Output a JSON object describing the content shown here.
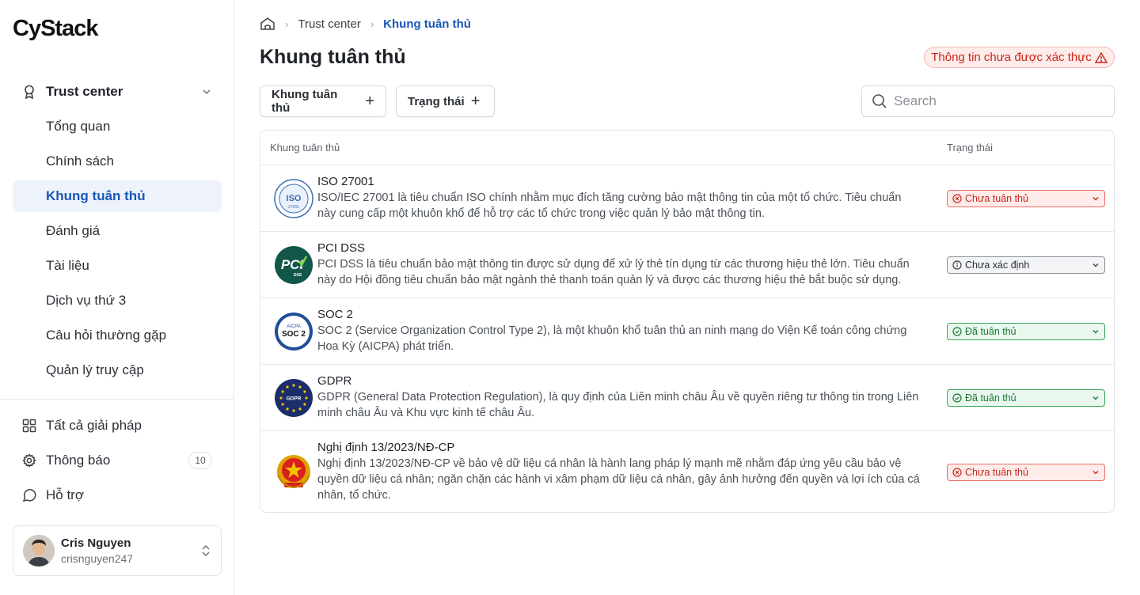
{
  "brand": {
    "logo_text": "CyStack"
  },
  "sidebar": {
    "group_label": "Trust center",
    "items": [
      {
        "label": "Tổng quan",
        "active": false
      },
      {
        "label": "Chính sách",
        "active": false
      },
      {
        "label": "Khung tuân thủ",
        "active": true
      },
      {
        "label": "Đánh giá",
        "active": false
      },
      {
        "label": "Tài liệu",
        "active": false
      },
      {
        "label": "Dịch vụ thứ 3",
        "active": false
      },
      {
        "label": "Câu hỏi thường gặp",
        "active": false
      },
      {
        "label": "Quản lý truy cập",
        "active": false
      }
    ],
    "bottom": [
      {
        "label": "Tất cả giải pháp",
        "icon": "grid-icon"
      },
      {
        "label": "Thông báo",
        "icon": "gear-icon",
        "badge": "10"
      },
      {
        "label": "Hỗ trợ",
        "icon": "chat-icon"
      }
    ],
    "user": {
      "name": "Cris Nguyen",
      "handle": "crisnguyen247"
    }
  },
  "breadcrumb": {
    "root": "Trust center",
    "current": "Khung tuân thủ"
  },
  "page": {
    "title": "Khung tuân thủ",
    "warning": "Thông tin chưa được xác thực"
  },
  "filters": {
    "framework": "Khung tuân thủ",
    "status": "Trạng thái"
  },
  "search": {
    "placeholder": "Search"
  },
  "table": {
    "headers": {
      "framework": "Khung tuân thủ",
      "status": "Trạng thái"
    },
    "rows": [
      {
        "name": "ISO 27001",
        "logo": "iso-logo",
        "desc": "ISO/IEC 27001 là tiêu chuẩn ISO chính nhằm mục đích tăng cường bảo mật thông tin của một tổ chức. Tiêu chuẩn này cung cấp một khuôn khổ để hỗ trợ các tổ chức trong việc quản lý bảo mật thông tin.",
        "status": "Chưa tuân thủ",
        "status_type": "red"
      },
      {
        "name": "PCI DSS",
        "logo": "pci-logo",
        "desc": "PCI DSS là tiêu chuẩn bảo mật thông tin được sử dụng để xử lý thẻ tín dụng từ các thương hiệu thẻ lớn. Tiêu chuẩn này do Hội đồng tiêu chuẩn bảo mật ngành thẻ thanh toán quản lý và được các thương hiệu thẻ bắt buộc sử dụng.",
        "status": "Chưa xác định",
        "status_type": "gray"
      },
      {
        "name": "SOC 2",
        "logo": "soc-logo",
        "desc": "SOC 2 (Service Organization Control Type 2), là một khuôn khổ tuân thủ an ninh mạng do Viện Kế toán công chứng Hoa Kỳ (AICPA) phát triển.",
        "status": "Đã tuân thủ",
        "status_type": "green"
      },
      {
        "name": "GDPR",
        "logo": "gdpr-logo",
        "desc": "GDPR (General Data Protection Regulation), là quy định của Liên minh châu Âu về quyền riêng tư thông tin trong Liên minh châu Âu và Khu vực kinh tế châu Âu.",
        "status": "Đã tuân thủ",
        "status_type": "green"
      },
      {
        "name": "Nghị định 13/2023/NĐ-CP",
        "logo": "vn-emblem-logo",
        "desc": "Nghị định 13/2023/NĐ-CP về bảo vệ dữ liệu cá nhân là hành lang pháp lý mạnh mẽ nhằm đáp ứng yêu cầu bảo vệ quyền dữ liệu cá nhân; ngăn chặn các hành vi xâm phạm dữ liệu cá nhân, gây ảnh hưởng đến quyền và lợi ích của cá nhân, tổ chức.",
        "status": "Chưa tuân thủ",
        "status_type": "red"
      }
    ]
  },
  "logo_texts": {
    "iso": "ISO",
    "iso_num": "27001",
    "pci": "PCI",
    "pci_sub": "DSS",
    "soc_top": "AICPA",
    "soc": "SOC 2",
    "gdpr": "GDPR"
  }
}
